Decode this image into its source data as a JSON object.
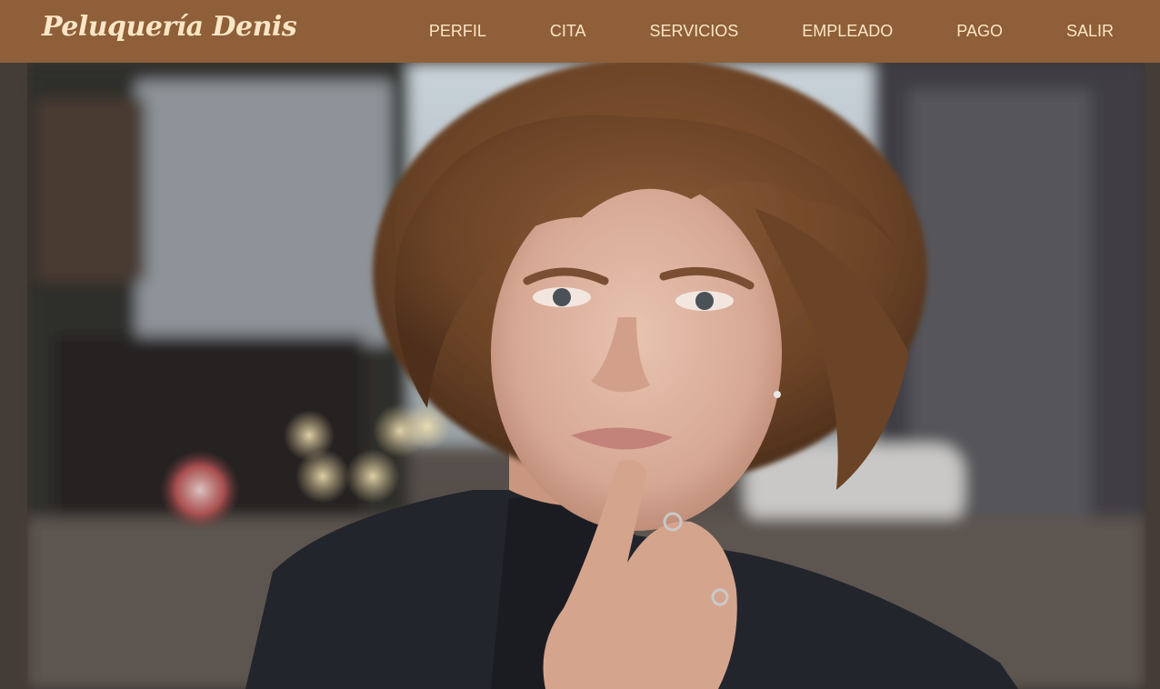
{
  "brand": {
    "name": "Peluquería Denis"
  },
  "nav": {
    "items": [
      {
        "label": "PERFIL"
      },
      {
        "label": "CITA"
      },
      {
        "label": "SERVICIOS"
      },
      {
        "label": "EMPLEADO"
      },
      {
        "label": "PAGO"
      },
      {
        "label": "SALIR"
      }
    ]
  },
  "theme": {
    "navbar_bg": "#8e5f38",
    "nav_text": "#fbe6c6"
  }
}
